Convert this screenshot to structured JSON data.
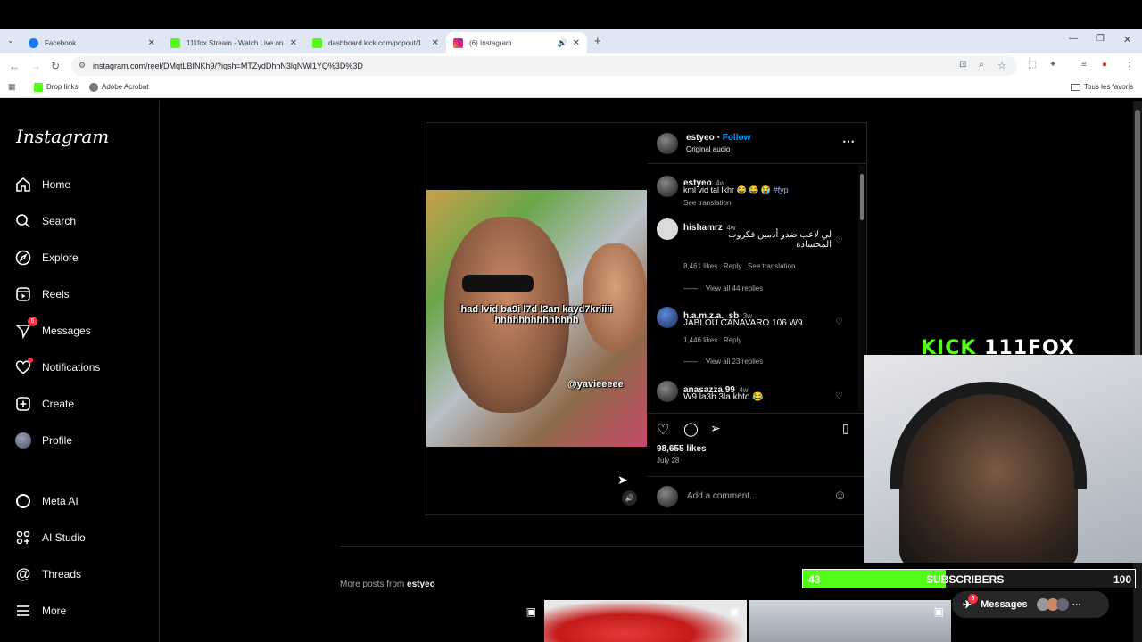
{
  "browser": {
    "tabs": [
      {
        "label": "Facebook",
        "color": "#1877f2"
      },
      {
        "label": "111fox Stream - Watch Live on",
        "color": "#53fc18"
      },
      {
        "label": "dashboard.kick.com/popout/1",
        "color": "#53fc18"
      },
      {
        "label": "(6) Instagram",
        "color": "#e1306c"
      }
    ],
    "url": "instagram.com/reel/DMqtLBfNKh9/?igsh=MTZydDhhN3lqNWl1YQ%3D%3D",
    "bookmarks": [
      "Drop links",
      "Adobe Acrobat"
    ],
    "all_bookmarks": "Tous les favoris"
  },
  "sidebar": {
    "logo": "Instagram",
    "items": [
      {
        "label": "Home",
        "icon": "home-icon"
      },
      {
        "label": "Search",
        "icon": "search-icon"
      },
      {
        "label": "Explore",
        "icon": "compass-icon"
      },
      {
        "label": "Reels",
        "icon": "reels-icon"
      },
      {
        "label": "Messages",
        "icon": "messenger-icon",
        "badge": "6"
      },
      {
        "label": "Notifications",
        "icon": "heart-icon"
      },
      {
        "label": "Create",
        "icon": "plus-square-icon"
      },
      {
        "label": "Profile",
        "icon": "avatar"
      },
      {
        "label": "Meta AI",
        "icon": "meta-ai-icon"
      },
      {
        "label": "AI Studio",
        "icon": "ai-studio-icon"
      },
      {
        "label": "Threads",
        "icon": "threads-icon"
      },
      {
        "label": "More",
        "icon": "menu-icon"
      }
    ]
  },
  "video": {
    "caption": "had lvid ba9i l7d l2an kayd7kniiii hhhhhhhhhhhhhh",
    "tag": "@yavieeeee"
  },
  "post": {
    "author": "estyeo",
    "follow": "Follow",
    "audio": "Original audio",
    "comments": [
      {
        "user": "estyeo",
        "age": "4w",
        "text": "kml vid tal lkhr 😂 😂 😭 #fyp",
        "hashtag": "#fyp",
        "sub": "See translation"
      },
      {
        "user": "hishamrz",
        "age": "4w",
        "text": "لي لاعب ضدو أدمين فكروب المحسادة",
        "likes": "8,461 likes",
        "reply": "Reply",
        "translate": "See translation",
        "replies": "View all 44 replies"
      },
      {
        "user": "h.a.m.z.a._sb",
        "age": "3w",
        "text": "JABLOU CANAVARO 106 W9",
        "likes": "1,446 likes",
        "reply": "Reply",
        "replies": "View all 23 replies"
      },
      {
        "user": "anasazza.99",
        "age": "4w",
        "text": "W9 la3b 3la khto 😂"
      }
    ],
    "likes": "98,655 likes",
    "date": "July 28",
    "add_comment": "Add a comment..."
  },
  "more_posts": {
    "prefix": "More posts from",
    "user": "estyeo"
  },
  "overlay": {
    "kick": "KICK",
    "channel": "111FOX",
    "subs_current": "43",
    "subs_label": "SUBSCRIBERS",
    "subs_goal": "100",
    "subs_progress": 0.43,
    "messages_label": "Messages",
    "messages_badge": "6"
  },
  "colors": {
    "accent_blue": "#0095f6",
    "kick_green": "#53fc18",
    "badge_red": "#ff3040"
  }
}
